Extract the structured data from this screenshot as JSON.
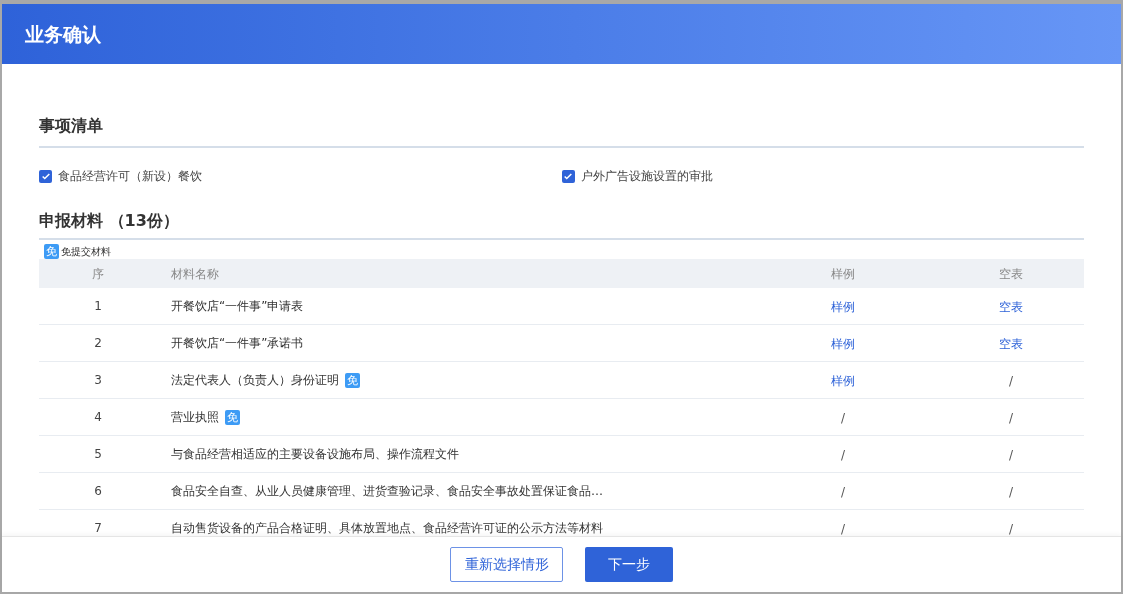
{
  "window": {
    "title": "业务确认"
  },
  "items_section": {
    "title": "事项清单",
    "items": [
      {
        "label": "食品经营许可（新设）餐饮",
        "checked": true
      },
      {
        "label": "户外广告设施设置的审批",
        "checked": true
      }
    ]
  },
  "materials_section": {
    "title": "申报材料 （13份）",
    "legend": {
      "badge": "免",
      "label": "免提交材料"
    }
  },
  "table": {
    "columns": [
      "序",
      "材料名称",
      "样例",
      "空表"
    ],
    "rows": [
      {
        "seq": "1",
        "name": "开餐饮店“一件事”申请表",
        "exempt": false,
        "sample": {
          "kind": "link",
          "text": "样例"
        },
        "blank": {
          "kind": "link",
          "text": "空表"
        }
      },
      {
        "seq": "2",
        "name": "开餐饮店“一件事”承诺书",
        "exempt": false,
        "sample": {
          "kind": "link",
          "text": "样例"
        },
        "blank": {
          "kind": "link",
          "text": "空表"
        }
      },
      {
        "seq": "3",
        "name": "法定代表人（负责人）身份证明",
        "exempt": true,
        "badge": "免",
        "sample": {
          "kind": "link",
          "text": "样例"
        },
        "blank": {
          "kind": "none",
          "text": "/"
        }
      },
      {
        "seq": "4",
        "name": "营业执照",
        "exempt": true,
        "badge": "免",
        "sample": {
          "kind": "none",
          "text": "/"
        },
        "blank": {
          "kind": "none",
          "text": "/"
        }
      },
      {
        "seq": "5",
        "name": "与食品经营相适应的主要设备设施布局、操作流程文件",
        "exempt": false,
        "sample": {
          "kind": "none",
          "text": "/"
        },
        "blank": {
          "kind": "none",
          "text": "/"
        }
      },
      {
        "seq": "6",
        "name": "食品安全自查、从业人员健康管理、进货查验记录、食品安全事故处置保证食品…",
        "exempt": false,
        "sample": {
          "kind": "none",
          "text": "/"
        },
        "blank": {
          "kind": "none",
          "text": "/"
        }
      },
      {
        "seq": "7",
        "name": "自动售货设备的产品合格证明、具体放置地点、食品经营许可证的公示方法等材料",
        "exempt": false,
        "sample": {
          "kind": "none",
          "text": "/"
        },
        "blank": {
          "kind": "none",
          "text": "/"
        }
      }
    ]
  },
  "buttons": [
    {
      "label": "重新选择情形",
      "kind": "secondary"
    },
    {
      "label": "下一步",
      "kind": "primary"
    }
  ]
}
